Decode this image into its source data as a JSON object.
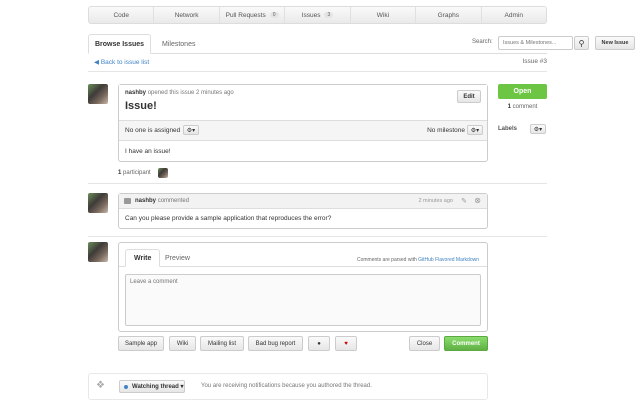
{
  "nav": {
    "items": [
      {
        "label": "Code",
        "count": ""
      },
      {
        "label": "Network",
        "count": ""
      },
      {
        "label": "Pull Requests",
        "count": "0"
      },
      {
        "label": "Issues",
        "count": "3"
      },
      {
        "label": "Wiki",
        "count": ""
      },
      {
        "label": "Graphs",
        "count": ""
      },
      {
        "label": "Admin",
        "count": ""
      }
    ]
  },
  "tabs": {
    "browse": "Browse Issues",
    "milestones": "Milestones"
  },
  "search": {
    "label": "Search:",
    "placeholder": "Issues & Milestones..."
  },
  "new_issue_label": "New Issue",
  "back_link": "Back to issue list",
  "issue_number": "Issue #3",
  "issue": {
    "author": "nashby",
    "opened_text": "opened this issue 2 minutes ago",
    "title": "Issue!",
    "edit_label": "Edit",
    "assignee_text": "No one is assigned",
    "milestone_text": "No milestone",
    "body": "I have an issue!"
  },
  "participants": {
    "count": "1",
    "label": "participant"
  },
  "sidebar": {
    "status": "Open",
    "comment_count": "1",
    "comment_label": "comment",
    "labels": "Labels"
  },
  "comment": {
    "author": "nashby",
    "action": "commented",
    "time": "2 minutes ago",
    "body": "Can you please provide a sample application that reproduces the error?"
  },
  "composer": {
    "write_tab": "Write",
    "preview_tab": "Preview",
    "note_prefix": "Comments are parsed with",
    "note_link": "GitHub Flavored Markdown",
    "placeholder": "Leave a comment"
  },
  "buttons": {
    "sample_app": "Sample app",
    "wiki": "Wiki",
    "mailing_list": "Mailing list",
    "bad_bug": "Bad bug report",
    "close": "Close",
    "comment": "Comment"
  },
  "watch": {
    "label": "Watching thread",
    "note": "You are receiving notifications because you authored the thread."
  },
  "colors": {
    "accent": "#4183c4",
    "open": "#6cc644",
    "comment_button": "#60b044"
  }
}
